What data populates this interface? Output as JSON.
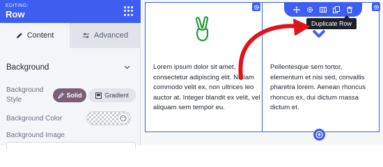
{
  "panel": {
    "editing_label": "EDITING:",
    "title": "Row",
    "tabs": [
      {
        "label": "Content",
        "icon": "pencil-icon",
        "active": true
      },
      {
        "label": "Advanced",
        "icon": "sliders-icon",
        "active": false
      }
    ],
    "section_title": "Background",
    "background_style_label": "Background Style",
    "style_options": [
      {
        "label": "Solid",
        "icon": "brush-icon",
        "selected": true
      },
      {
        "label": "Gradient",
        "icon": "gradient-icon",
        "selected": false
      }
    ],
    "background_color_label": "Background Color",
    "background_image_label": "Background Image"
  },
  "canvas": {
    "left_column_text": "Lorem ipsum dolor sit amet, consectetur adipiscing elit. Nullam commodo velit ex, non ultrices leo auctor at. Integer blandit ex velit, vel aliquam sem tempor eu.",
    "right_column_text": "Pellentesque sem tortor, elementum et nisi sed, convallis pharetra lorem. Aenean rhoncus rhoncus ex, dui dictum massa dictum et.",
    "toolbar_icons": [
      "move-icon",
      "gear-icon",
      "columns-icon",
      "duplicate-icon",
      "trash-icon"
    ],
    "tooltip": "Duplicate Row"
  },
  "colors": {
    "accent": "#3d5ef0",
    "solid_button": "#7b5f74",
    "peace_icon": "#1f9a3c",
    "arrow": "#e0131b",
    "tooltip_bg": "#1d2029"
  }
}
